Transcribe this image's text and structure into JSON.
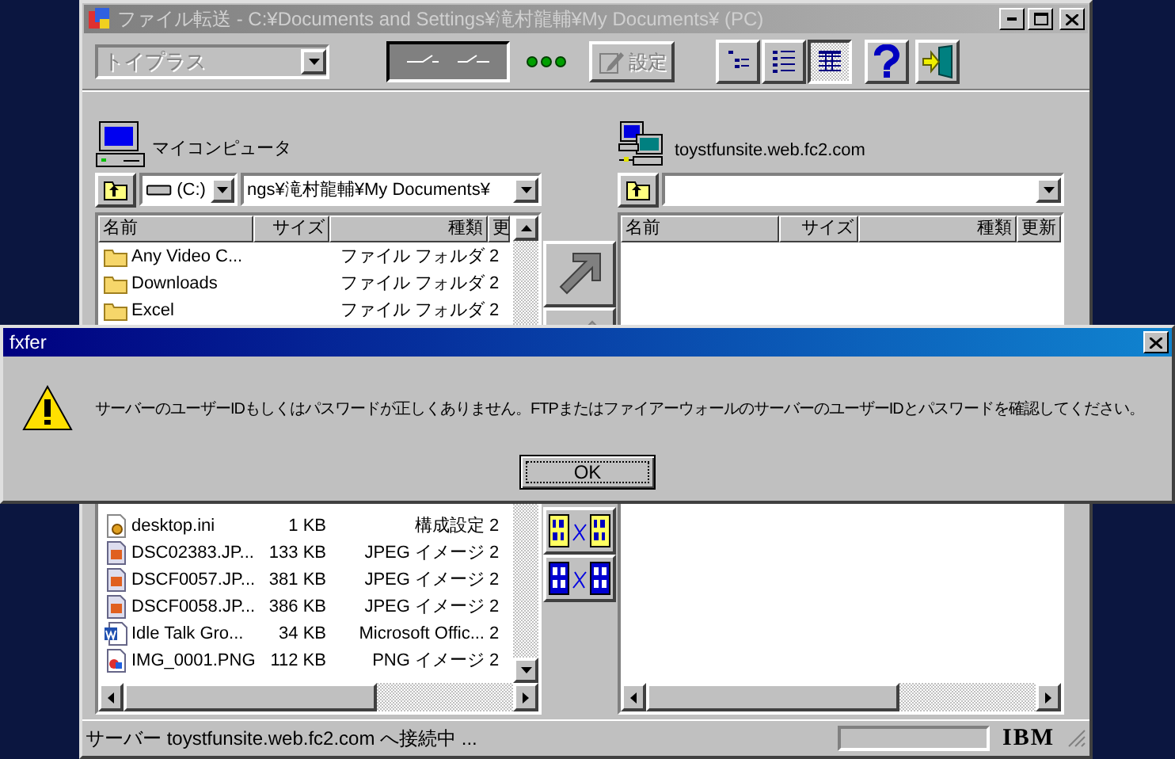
{
  "window": {
    "title": "ファイル転送 - C:¥Documents and Settings¥滝村龍輔¥My Documents¥ (PC)"
  },
  "toolbar": {
    "profile_combo": {
      "value": "トイプラス",
      "disabled": true
    },
    "settings_button": {
      "label": "設定",
      "disabled": true
    },
    "view_buttons": [
      {
        "kind": "tree",
        "selected": false
      },
      {
        "kind": "list",
        "selected": false
      },
      {
        "kind": "details",
        "selected": true
      }
    ]
  },
  "local_pane": {
    "label": "マイコンピュータ",
    "drive": "(C:)",
    "path": "ngs¥滝村龍輔¥My Documents¥",
    "columns": [
      "名前",
      "サイズ",
      "種類",
      "更"
    ],
    "rows_top": [
      {
        "kind": "folder",
        "name": "Any Video C...",
        "type": "ファイル フォルダ",
        "column_4": "2"
      },
      {
        "kind": "folder",
        "name": "Downloads",
        "type": "ファイル フォルダ",
        "column_4": "2"
      },
      {
        "kind": "folder",
        "name": "Excel",
        "type": "ファイル フォルダ",
        "column_4": "2"
      }
    ],
    "rows_bottom": [
      {
        "kind": "settings",
        "name": "desktop.ini",
        "size": "1 KB",
        "type": "構成設定",
        "column_4": "2"
      },
      {
        "kind": "image",
        "name": "DSC02383.JP...",
        "size": "133 KB",
        "type": "JPEG イメージ",
        "column_4": "2"
      },
      {
        "kind": "image",
        "name": "DSCF0057.JP...",
        "size": "381 KB",
        "type": "JPEG イメージ",
        "column_4": "2"
      },
      {
        "kind": "image",
        "name": "DSCF0058.JP...",
        "size": "386 KB",
        "type": "JPEG イメージ",
        "column_4": "2"
      },
      {
        "kind": "document",
        "name": "Idle Talk Gro...",
        "size": "34 KB",
        "type": "Microsoft Offic...",
        "column_4": "2"
      },
      {
        "kind": "png",
        "name": "IMG_0001.PNG",
        "size": "112 KB",
        "type": "PNG イメージ",
        "column_4": "2"
      }
    ]
  },
  "remote_pane": {
    "host": "toystfunsite.web.fc2.com",
    "columns": [
      "名前",
      "サイズ",
      "種類",
      "更新"
    ]
  },
  "status_bar": {
    "text": "サーバー toystfunsite.web.fc2.com へ接続中 ...",
    "logo": "IBM"
  },
  "dialog": {
    "title": "fxfer",
    "message": "サーバーのユーザーIDもしくはパスワードが正しくありません。FTPまたはファイアーウォールのサーバーのユーザーIDとパスワードを確認してください。",
    "button": "OK"
  }
}
